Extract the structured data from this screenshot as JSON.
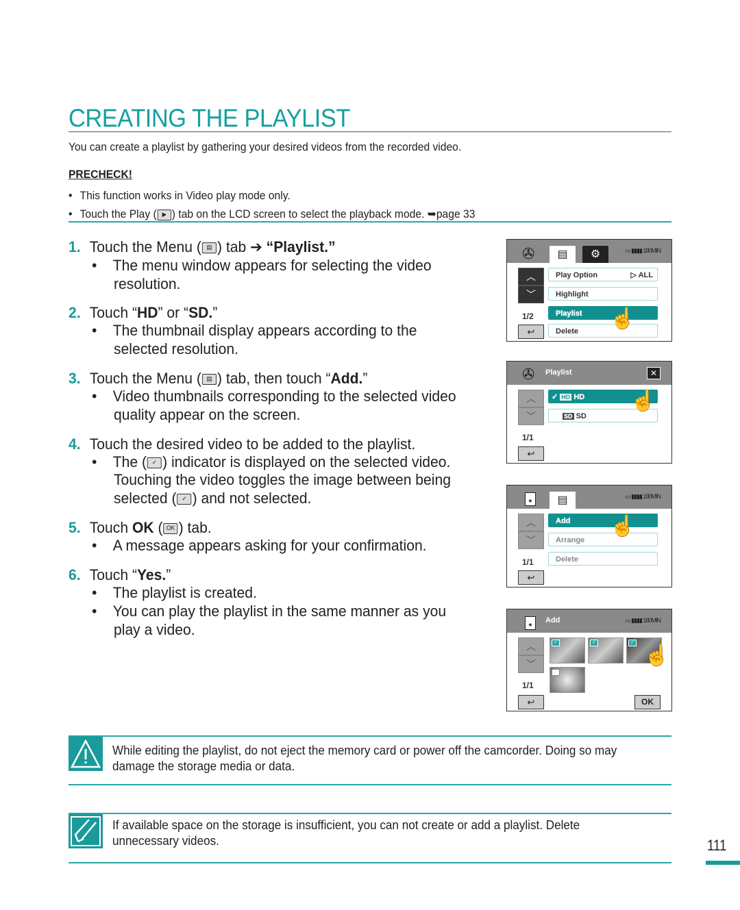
{
  "title": "CREATING THE PLAYLIST",
  "intro": "You can create a playlist by gathering your desired videos from the recorded video.",
  "precheck": {
    "heading": "PRECHECK!",
    "items": [
      "This function works in Video play mode only.",
      {
        "before": "Touch the Play (",
        "icon": "play-tab-icon",
        "after": ") tab on the LCD screen to select the playback mode. ",
        "ref_arrow": "➥",
        "ref": "page 33"
      }
    ]
  },
  "steps": [
    {
      "num": "1.",
      "text_before": "Touch the Menu (",
      "icon": "menu-tab-icon",
      "text_after": ") tab ",
      "arrow": "➔",
      "bold": "“Playlist.”",
      "bullets": [
        [
          "The menu window appears for selecting the video",
          "resolution."
        ]
      ]
    },
    {
      "num": "2.",
      "text_a": "Touch “",
      "bold_a": "HD",
      "text_b": "” or “",
      "bold_b": "SD.",
      "text_c": "”",
      "bullets": [
        [
          "The thumbnail display appears according to the",
          "selected resolution."
        ]
      ]
    },
    {
      "num": "3.",
      "text_before": "Touch the Menu (",
      "icon": "menu-tab-icon",
      "text_after": ") tab, then touch “",
      "bold": "Add.",
      "text_end": "”",
      "bullets": [
        [
          "Video thumbnails corresponding to the selected video",
          "quality appear on the screen."
        ]
      ]
    },
    {
      "num": "4.",
      "text": "Touch the desired video to be added to the playlist.",
      "bullets": [
        {
          "l1_before": "The (",
          "l1_after": ") indicator is displayed on the selected video.",
          "l2": "Touching the video toggles the image between being",
          "l3_before": "selected (",
          "l3_after": ") and not selected."
        }
      ]
    },
    {
      "num": "5.",
      "text_before": "Touch ",
      "bold": "OK",
      "text_mid": " (",
      "icon_label": "OK",
      "text_after": ") tab.",
      "bullets": [
        [
          "A message appears asking for your confirmation."
        ]
      ]
    },
    {
      "num": "6.",
      "text_before": "Touch “",
      "bold": "Yes.",
      "text_after": "”",
      "bullets": [
        [
          "The playlist is created."
        ],
        [
          "You can play the playlist in the same manner as you",
          "play a video."
        ]
      ]
    }
  ],
  "screens": [
    {
      "page": "1/2",
      "items": [
        "Play Option",
        "Highlight",
        "Playlist",
        "Delete"
      ],
      "play_option_value": "▷ ALL",
      "selected": "Playlist",
      "status": "▭ ▮▮▮▮ 180MIN"
    },
    {
      "title": "Playlist",
      "page": "1/1",
      "items": [
        "HD",
        "SD"
      ],
      "badges": [
        "HD",
        "SD"
      ],
      "selected": "HD",
      "close": "✕"
    },
    {
      "page": "1/1",
      "items": [
        "Add",
        "Arrange",
        "Delete"
      ],
      "selected": "Add",
      "status": "▭ ▮▮▮▮ 180MIN"
    },
    {
      "title": "Add",
      "page": "1/1",
      "ok": "OK",
      "status": "▭ ▮▮▮▮ 180MIN",
      "thumbnails_checked": [
        true,
        true,
        true,
        false
      ]
    }
  ],
  "glyphs": {
    "up": "︿",
    "down": "﹀",
    "back": "↩",
    "hand": "☝",
    "check": "✓",
    "gear": "⚙",
    "menu": "▤",
    "reel": "✇",
    "star": "★"
  },
  "notes": {
    "warning": "While editing the playlist, do not eject the memory card or power off the camcorder. Doing so may damage the storage media or data.",
    "memo": "If available space on the storage is insufficient, you can not create or add a playlist. Delete unnecessary videos."
  },
  "page_number": "111",
  "colors": {
    "accent": "#1a9a9a",
    "highlight": "#129090"
  }
}
